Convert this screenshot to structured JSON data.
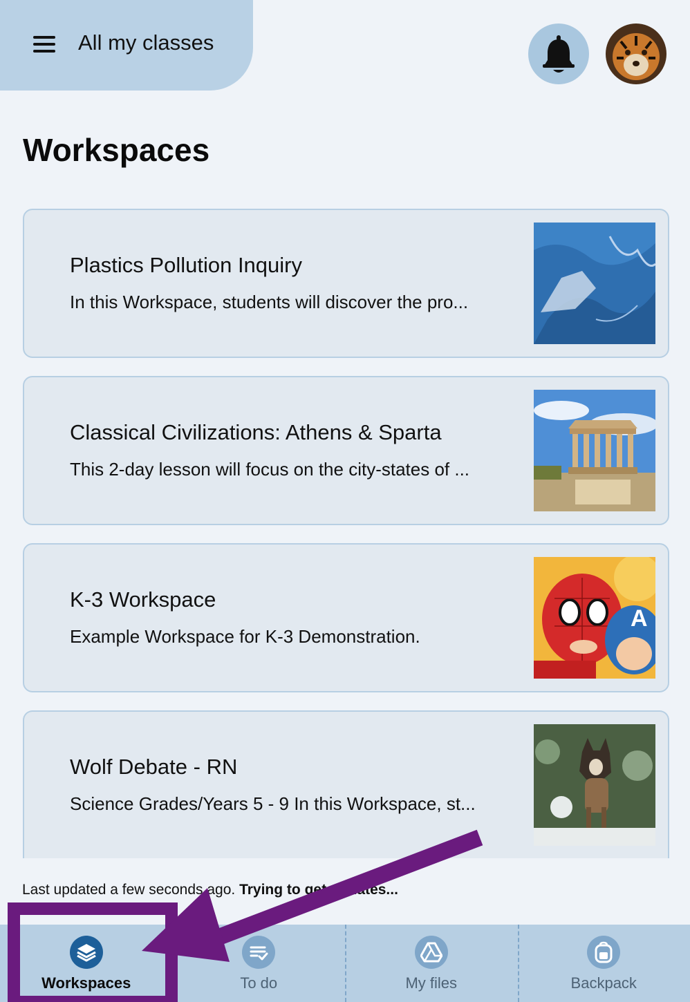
{
  "header": {
    "menu_icon": "hamburger-menu-icon",
    "title": "All my classes",
    "notification_icon": "bell-icon",
    "avatar_icon": "tiger-avatar"
  },
  "page_title": "Workspaces",
  "workspaces": [
    {
      "title": "Plastics Pollution Inquiry",
      "description": "In this Workspace, students will discover the pro...",
      "thumbnail": "ocean-plastic-image"
    },
    {
      "title": "Classical Civilizations: Athens & Sparta",
      "description": "This 2-day lesson will focus on the city-states of ...",
      "thumbnail": "parthenon-image"
    },
    {
      "title": "K-3 Workspace",
      "description": "Example Workspace for K-3 Demonstration.",
      "thumbnail": "kids-superheroes-image"
    },
    {
      "title": "Wolf Debate - RN",
      "description": "Science Grades/Years 5 - 9 In this Workspace, st...",
      "thumbnail": "wolf-dog-image"
    }
  ],
  "status": {
    "updated_text": "Last updated a few seconds ago.",
    "trying_text": "Trying to get updates..."
  },
  "bottom_nav": [
    {
      "label": "Workspaces",
      "icon": "layers-icon",
      "active": true
    },
    {
      "label": "To do",
      "icon": "checklist-icon",
      "active": false
    },
    {
      "label": "My files",
      "icon": "drive-icon",
      "active": false
    },
    {
      "label": "Backpack",
      "icon": "backpack-icon",
      "active": false
    }
  ],
  "colors": {
    "background": "#eff3f8",
    "header_tab": "#b9d1e5",
    "card_background": "#e2e9f0",
    "card_border": "#b7cfe3",
    "nav_background": "#b7cfe3",
    "active_icon": "#1d5f99",
    "inactive_icon": "#7fa6c9",
    "annotation_purple": "#6a1b7e"
  }
}
